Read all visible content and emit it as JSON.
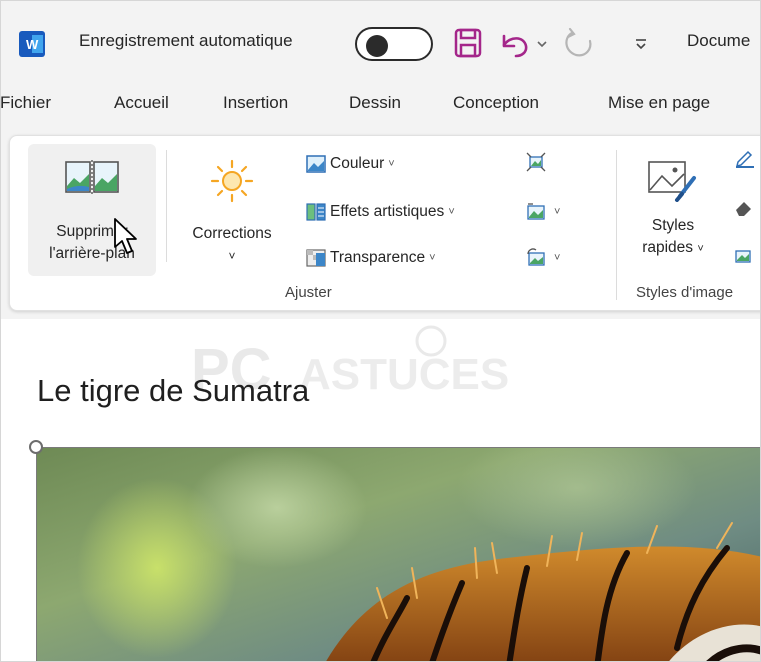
{
  "titlebar": {
    "autosave_label": "Enregistrement automatique",
    "doc_title": "Docume",
    "icons": [
      "word-icon",
      "save-icon",
      "undo-icon",
      "redo-icon",
      "customize-qat-icon"
    ]
  },
  "tabs": [
    {
      "label": "Fichier"
    },
    {
      "label": "Accueil"
    },
    {
      "label": "Insertion"
    },
    {
      "label": "Dessin"
    },
    {
      "label": "Conception"
    },
    {
      "label": "Mise en page"
    }
  ],
  "ribbon": {
    "remove_bg": {
      "line1": "Supprimer",
      "line2": "l'arrière-plan"
    },
    "corrections": {
      "label": "Corrections",
      "chev": "˅"
    },
    "couleur": "Couleur",
    "effets": "Effets artistiques",
    "transparence": "Transparence",
    "styles": {
      "line1": "Styles",
      "line2": "rapides"
    },
    "group_adjust": "Ajuster",
    "group_styles": "Styles d'image",
    "chev": "˅"
  },
  "document": {
    "heading": "Le tigre de Sumatra",
    "watermark": "PC ASTUCES"
  },
  "colors": {
    "word_blue": "#185abd",
    "save_purple": "#a4268a",
    "sun_orange": "#f5a623",
    "tab_text": "#262626"
  }
}
